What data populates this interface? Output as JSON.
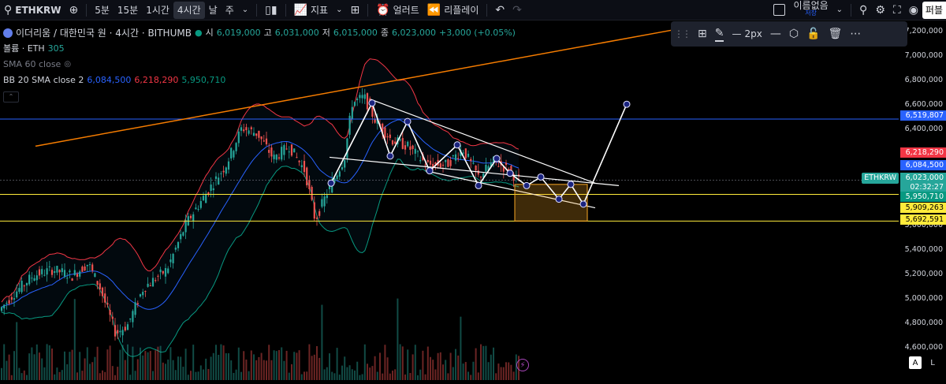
{
  "toolbar": {
    "symbol": "ETHKRW",
    "intervals": [
      "5분",
      "15분",
      "1시간",
      "4시간",
      "날",
      "주"
    ],
    "active_interval": "4시간",
    "indicators_label": "지표",
    "alert_label": "얼러트",
    "replay_label": "리플레이",
    "save_label": "이름없음",
    "save_sub": "저장",
    "publish_label": "퍼블"
  },
  "legend": {
    "symbol_title": "이더리움 / 대한민국 원 · 4시간 · BITHUMB",
    "open_label": "시",
    "open": "6,019,000",
    "high_label": "고",
    "high": "6,031,000",
    "low_label": "저",
    "low": "6,015,000",
    "close_label": "종",
    "close": "6,023,000",
    "change": "+3,000 (+0.05%)",
    "volume_label": "볼륨 · ETH",
    "volume_value": "305",
    "sma_label": "SMA 60 close",
    "bb_label": "BB 20 SMA close 2",
    "bb_basis": "6,084,500",
    "bb_upper": "6,218,290",
    "bb_lower": "5,950,710"
  },
  "draw_toolbar": {
    "width_label": "2px"
  },
  "price_scale": {
    "ticks": [
      "7,200,000",
      "7,000,000",
      "6,800,000",
      "6,600,000",
      "6,400,000",
      "5,600,000",
      "5,400,000",
      "5,200,000",
      "5,000,000",
      "4,800,000",
      "4,600,000"
    ],
    "tags": [
      {
        "value": "6,519,807",
        "bg": "#2962ff",
        "color": "#ffffff"
      },
      {
        "value": "6,218,290",
        "bg": "#f23645",
        "color": "#ffffff"
      },
      {
        "value": "6,084,500",
        "bg": "#2962ff",
        "color": "#ffffff"
      },
      {
        "value": "6,023,000",
        "bg": "#26a69a",
        "color": "#ffffff"
      },
      {
        "value": "02:32:27",
        "bg": "#26a69a",
        "color": "#ffffff"
      },
      {
        "value": "5,950,710",
        "bg": "#089981",
        "color": "#ffffff"
      },
      {
        "value": "5,909,263",
        "bg": "#ffeb3b",
        "color": "#000000"
      },
      {
        "value": "5,692,591",
        "bg": "#ffeb3b",
        "color": "#000000"
      }
    ],
    "symbol_tag": "ETHKRW"
  },
  "corner": {
    "auto_label": "A",
    "log_label": "L"
  },
  "colors": {
    "up": "#26a69a",
    "down": "#ef5350",
    "bb_upper": "#f23645",
    "bb_lower": "#089981",
    "bb_basis": "#2962ff",
    "trend": "#f57c00",
    "hline_blue": "#2962ff",
    "hline_yellow": "#ffeb3b",
    "pattern": "#ffffff",
    "box": "#f9a825"
  },
  "chart_data": {
    "type": "candlestick",
    "symbol": "ETHKRW",
    "exchange": "BITHUMB",
    "interval": "4h",
    "last_close": 6023000,
    "horizontal_lines": [
      6519807,
      5909263,
      5692591
    ],
    "bollinger": {
      "basis": 6084500,
      "upper": 6218290,
      "lower": 5950710
    },
    "ylim": [
      4550000,
      7300000
    ],
    "price_path": [
      [
        0,
        4950000
      ],
      [
        20,
        5100000
      ],
      [
        45,
        5250000
      ],
      [
        70,
        5300000
      ],
      [
        95,
        5250000
      ],
      [
        115,
        5350000
      ],
      [
        130,
        5150000
      ],
      [
        150,
        4780000
      ],
      [
        165,
        4850000
      ],
      [
        185,
        5150000
      ],
      [
        215,
        5300000
      ],
      [
        240,
        5680000
      ],
      [
        265,
        5920000
      ],
      [
        290,
        6150000
      ],
      [
        310,
        6450000
      ],
      [
        330,
        6400000
      ],
      [
        350,
        6200000
      ],
      [
        370,
        6300000
      ],
      [
        390,
        6100000
      ],
      [
        403,
        5700000
      ],
      [
        420,
        5950000
      ],
      [
        440,
        6200000
      ],
      [
        450,
        6650000
      ],
      [
        465,
        6700000
      ],
      [
        480,
        6500000
      ],
      [
        500,
        6350000
      ],
      [
        520,
        6300000
      ],
      [
        545,
        6150000
      ],
      [
        570,
        6150000
      ],
      [
        590,
        6280000
      ],
      [
        610,
        6050000
      ],
      [
        630,
        6180000
      ],
      [
        650,
        6100000
      ],
      [
        660,
        6023000
      ]
    ],
    "pattern_points": [
      [
        420,
        6000000
      ],
      [
        472,
        6650000
      ],
      [
        495,
        6220000
      ],
      [
        517,
        6500000
      ],
      [
        545,
        6100000
      ],
      [
        580,
        6310000
      ],
      [
        607,
        5980000
      ],
      [
        630,
        6200000
      ],
      [
        647,
        6080000
      ],
      [
        668,
        5980000
      ],
      [
        686,
        6050000
      ],
      [
        709,
        5870000
      ],
      [
        724,
        5990000
      ],
      [
        740,
        5830000
      ],
      [
        795,
        6640000
      ]
    ]
  }
}
